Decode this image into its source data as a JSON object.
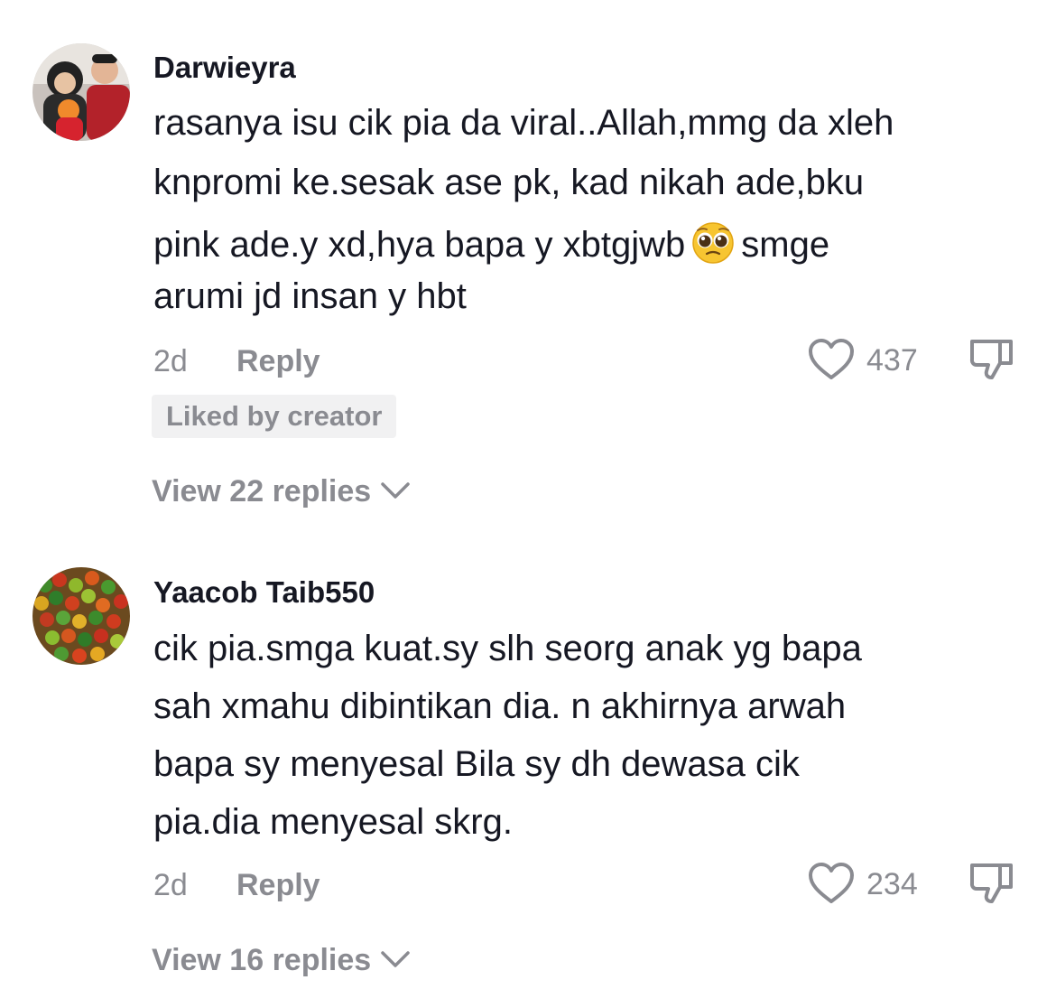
{
  "comments": [
    {
      "username": "Darwieyra",
      "text_lines": [
        "rasanya isu cik pia da viral..Allah,mmg da xleh",
        "knpromi ke.sesak ase pk, kad nikah ade,bku",
        "pink ade.y xd,hya bapa y xbtgjwb",
        "smge",
        "arumi jd insan y hbt"
      ],
      "inline_emoji": "pleading-face",
      "time": "2d",
      "reply_label": "Reply",
      "likes": "437",
      "badge": "Liked by creator",
      "view_replies": "View 22 replies"
    },
    {
      "username": "Yaacob Taib550",
      "text_lines": [
        "cik pia.smga kuat.sy slh seorg anak yg bapa",
        "sah xmahu dibintikan dia. n akhirnya arwah",
        "bapa sy menyesal Bila sy dh dewasa cik",
        "pia.dia menyesal skrg."
      ],
      "time": "2d",
      "reply_label": "Reply",
      "likes": "234",
      "view_replies": "View 16 replies"
    }
  ],
  "icons": {
    "like": "heart-outline-icon",
    "dislike": "thumbs-down-outline-icon",
    "expand": "chevron-down-icon"
  },
  "colors": {
    "primary_text": "#161823",
    "secondary_text": "#8a8b91",
    "badge_bg": "#f1f1f2"
  }
}
